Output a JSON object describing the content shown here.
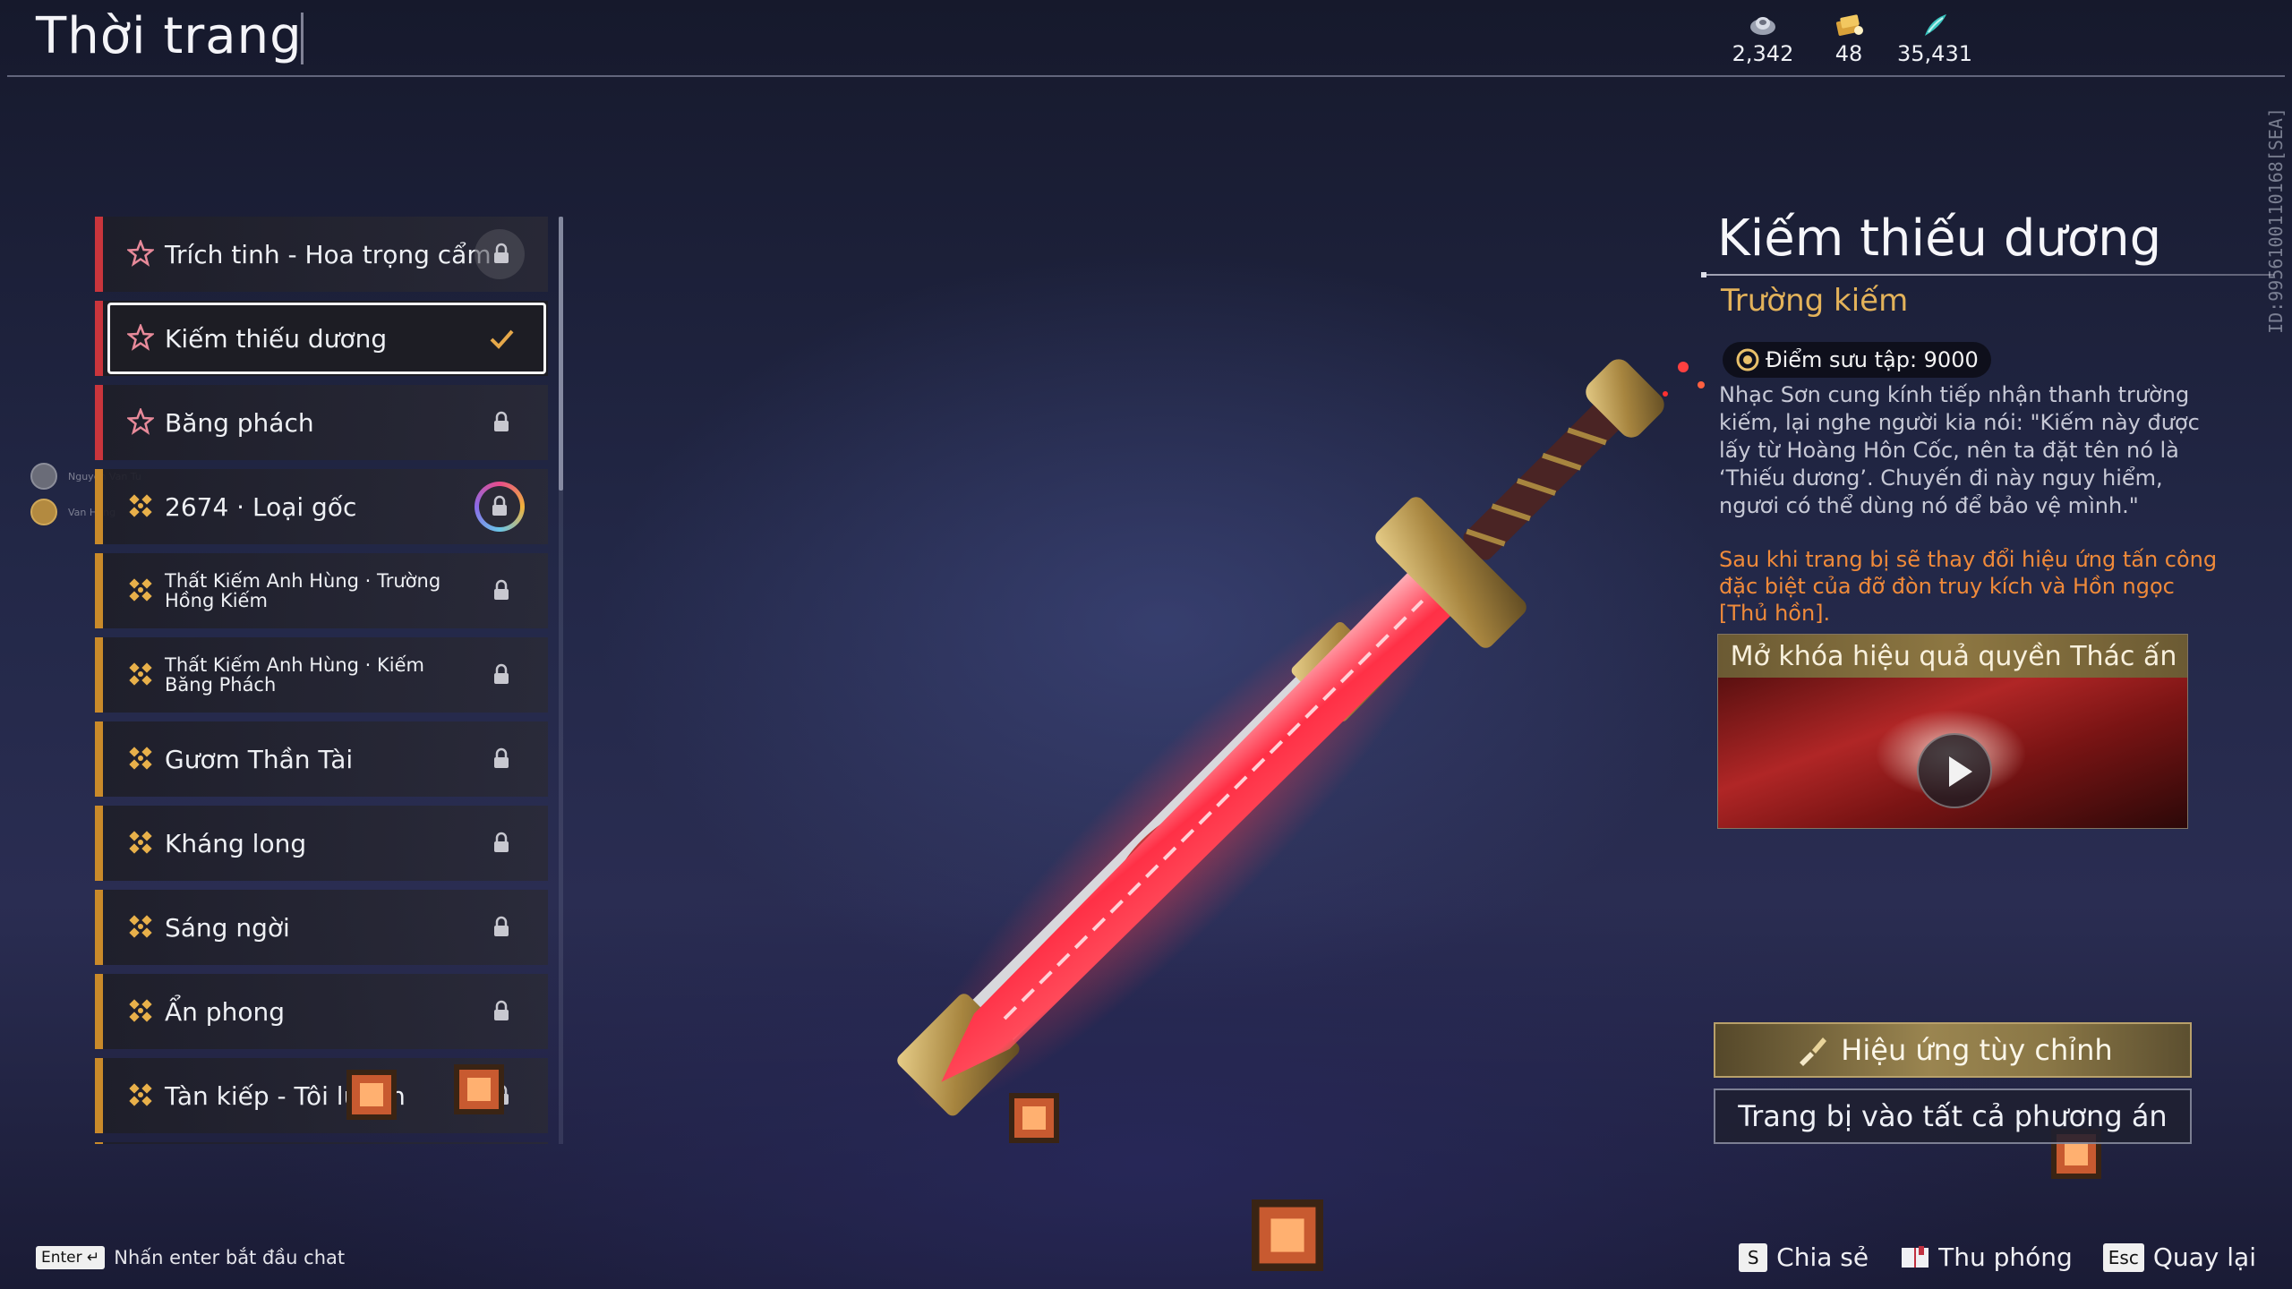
{
  "header": {
    "title": "Thời trang",
    "currencies": [
      {
        "icon": "silver-ingot-icon",
        "value": "2,342"
      },
      {
        "icon": "gold-ticket-icon",
        "value": "48"
      },
      {
        "icon": "jade-feather-icon",
        "value": "35,431"
      }
    ],
    "build_id": "ID:9956100110168[SEA]"
  },
  "list": {
    "items": [
      {
        "label": "Trích tinh - Hoa trọng cẩm",
        "rarity": "red",
        "state": "locked"
      },
      {
        "label": "Kiếm thiếu dương",
        "rarity": "red",
        "state": "equipped"
      },
      {
        "label": "Băng phách",
        "rarity": "red",
        "state": "locked"
      },
      {
        "label": "2674 · Loại gốc",
        "rarity": "gold",
        "state": "locked-special"
      },
      {
        "label": "Thất Kiếm Anh Hùng · Trường Hồng Kiếm",
        "rarity": "gold",
        "state": "locked"
      },
      {
        "label": "Thất Kiếm Anh Hùng · Kiếm Băng Phách",
        "rarity": "gold",
        "state": "locked"
      },
      {
        "label": "Gươm Thần Tài",
        "rarity": "gold",
        "state": "locked"
      },
      {
        "label": "Kháng long",
        "rarity": "gold",
        "state": "locked"
      },
      {
        "label": "Sáng ngời",
        "rarity": "gold",
        "state": "locked"
      },
      {
        "label": "Ẩn phong",
        "rarity": "gold",
        "state": "locked"
      },
      {
        "label": "Tàn kiếp - Tôi luyện",
        "rarity": "gold",
        "state": "locked"
      }
    ],
    "friends": [
      {
        "name": "Nguyen Van Tu"
      },
      {
        "name": "Van Hung"
      }
    ]
  },
  "detail": {
    "name": "Kiếm thiếu dương",
    "type": "Trường kiếm",
    "points": "Điểm sưu tập: 9000",
    "description": "Nhạc Sơn cung kính tiếp nhận thanh trường kiếm, lại nghe người kia nói: \"Kiếm này được lấy từ Hoàng Hôn Cốc, nên ta đặt tên nó là ‘Thiếu dương’. Chuyến đi này nguy hiểm, ngươi có thể dùng nó để bảo vệ mình.\"",
    "effect_note": "Sau khi trang bị sẽ thay đổi hiệu ứng tấn công đặc biệt của đỡ đòn truy kích và Hồn ngọc [Thủ hồn].",
    "video_title": "Mở khóa hiệu quả quyền Thác ấn",
    "btn_effect": "Hiệu ứng tùy chỉnh",
    "btn_equip": "Trang bị vào tất cả phương án"
  },
  "footer": {
    "enter_key": "Enter",
    "chat_hint": "Nhấn enter bắt đầu chat",
    "share_key": "S",
    "share": "Chia sẻ",
    "zoom": "Thu phóng",
    "back_key": "Esc",
    "back": "Quay lại"
  },
  "colors": {
    "accent_gold": "#e3b25a",
    "effect_orange": "#f08a3a",
    "rarity_red": "#c9353c",
    "rarity_gold": "#c98a2a"
  }
}
